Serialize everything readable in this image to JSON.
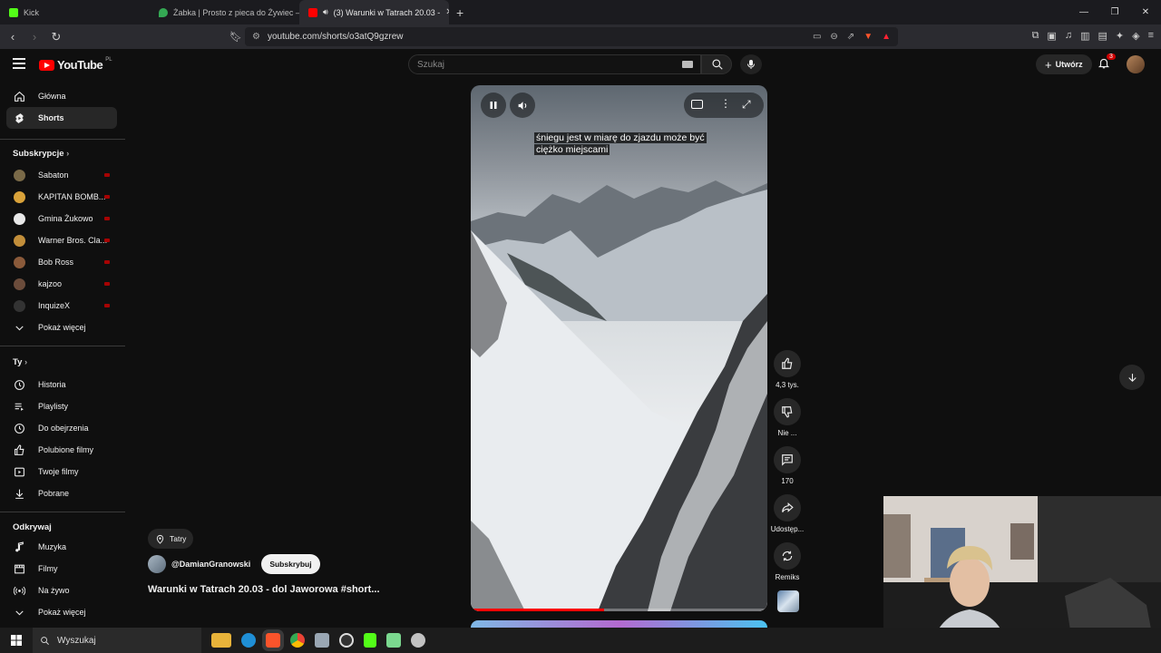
{
  "browser": {
    "tabs": [
      {
        "title": "Kick",
        "color": "#53fc18"
      },
      {
        "title": "Żabka | Prosto z pieca do Żywiec – M",
        "color": "#34a853"
      },
      {
        "title": "(3) Warunki w Tatrach 20.03 -",
        "color": "#ff0000"
      }
    ],
    "url": "youtube.com/shorts/o3atQ9gzrew"
  },
  "header": {
    "logo_text": "YouTube",
    "logo_country": "PL",
    "search_placeholder": "Szukaj",
    "create_label": "Utwórz",
    "notification_count": "3"
  },
  "sidebar": {
    "main": [
      {
        "label": "Główna",
        "icon": "home-icon"
      },
      {
        "label": "Shorts",
        "icon": "shorts-icon"
      }
    ],
    "subscriptions_title": "Subskrypcje",
    "subscriptions": [
      {
        "label": "Sabaton",
        "color": "#7a6a48"
      },
      {
        "label": "KAPITAN BOMB...",
        "color": "#d9a23a"
      },
      {
        "label": "Gmina Żukowo",
        "color": "#e8e8e8"
      },
      {
        "label": "Warner Bros. Cla...",
        "color": "#c28e3a"
      },
      {
        "label": "Bob Ross",
        "color": "#8a5a3a"
      },
      {
        "label": "kajzoo",
        "color": "#6b4c3b"
      },
      {
        "label": "InquizeX",
        "color": "#333333"
      }
    ],
    "show_more": "Pokaż więcej",
    "you_title": "Ty",
    "you_items": [
      {
        "label": "Historia",
        "icon": "history-icon"
      },
      {
        "label": "Playlisty",
        "icon": "playlist-icon"
      },
      {
        "label": "Do obejrzenia",
        "icon": "clock-icon"
      },
      {
        "label": "Polubione filmy",
        "icon": "thumbs-up-icon"
      },
      {
        "label": "Twoje filmy",
        "icon": "video-icon"
      },
      {
        "label": "Pobrane",
        "icon": "download-icon"
      }
    ],
    "explore_title": "Odkrywaj",
    "explore_items": [
      {
        "label": "Muzyka",
        "icon": "music-icon"
      },
      {
        "label": "Filmy",
        "icon": "film-icon"
      },
      {
        "label": "Na żywo",
        "icon": "live-icon"
      }
    ],
    "explore_more": "Pokaż więcej"
  },
  "short": {
    "subtitle_line1": "śniegu jest w miarę do zjazdu może być",
    "subtitle_line2": "ciężko miejscami",
    "progress": 0.45,
    "location": "Tatry",
    "channel": "@DamianGranowski",
    "subscribe_label": "Subskrybuj",
    "title": "Warunki w Tatrach 20.03 - dol Jaworowa #short..."
  },
  "actions": {
    "likes": "4,3 tys.",
    "dislike": "Nie ...",
    "comments": "170",
    "share": "Udostęp...",
    "remix": "Remiks"
  },
  "taskbar": {
    "search_placeholder": "Wyszukaj"
  }
}
